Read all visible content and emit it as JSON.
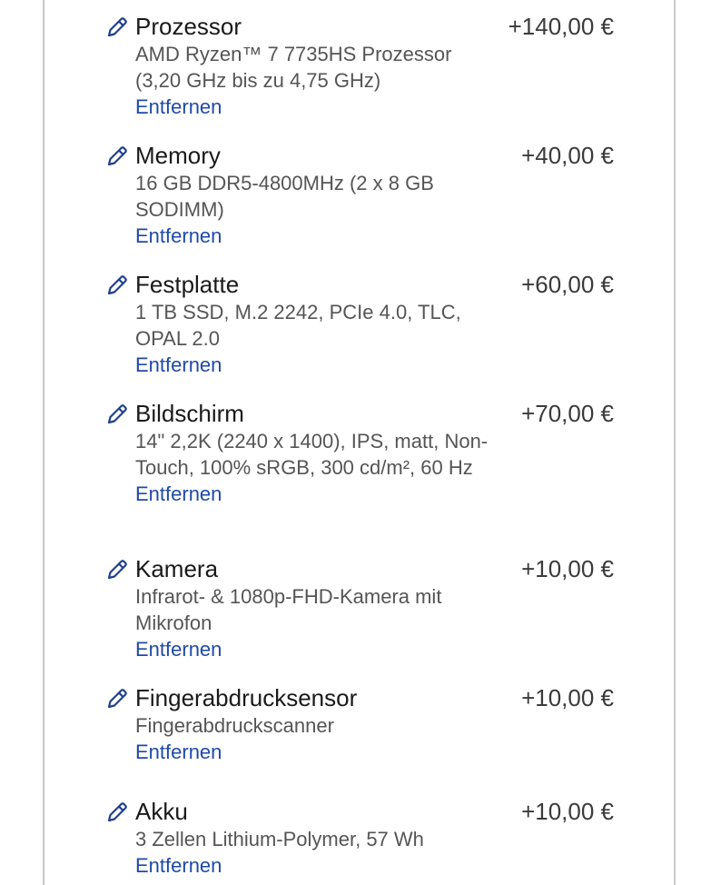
{
  "colors": {
    "title": "#1a1a1a",
    "price": "#3a3a3a",
    "description": "#555555",
    "link": "#1f4aa8",
    "icon": "#1f3f8f",
    "border": "#c9c9c9"
  },
  "items": [
    {
      "title": "Prozessor",
      "price": "+140,00 €",
      "description": "AMD Ryzen™ 7 7735HS Prozessor (3,20 GHz bis zu 4,75 GHz)",
      "remove_label": "Entfernen",
      "icon": "pencil-icon"
    },
    {
      "title": "Memory",
      "price": "+40,00 €",
      "description": "16 GB DDR5-4800MHz (2 x 8 GB SODIMM)",
      "remove_label": "Entfernen",
      "icon": "pencil-icon"
    },
    {
      "title": "Festplatte",
      "price": "+60,00 €",
      "description": "1 TB SSD, M.2 2242, PCIe 4.0, TLC, OPAL 2.0",
      "remove_label": "Entfernen",
      "icon": "pencil-icon"
    },
    {
      "title": "Bildschirm",
      "price": "+70,00 €",
      "description": "14\" 2,2K (2240 x 1400), IPS, matt, Non-Touch, 100% sRGB, 300 cd/m², 60 Hz",
      "remove_label": "Entfernen",
      "icon": "pencil-icon"
    },
    {
      "title": "Kamera",
      "price": "+10,00 €",
      "description": "Infrarot- & 1080p-FHD-Kamera mit Mikrofon",
      "remove_label": "Entfernen",
      "icon": "pencil-icon"
    },
    {
      "title": "Fingerabdrucksensor",
      "price": "+10,00 €",
      "description": "Fingerabdruckscanner",
      "remove_label": "Entfernen",
      "icon": "pencil-icon"
    },
    {
      "title": "Akku",
      "price": "+10,00 €",
      "description": "3 Zellen Lithium-Polymer, 57 Wh",
      "remove_label": "Entfernen",
      "icon": "pencil-icon"
    }
  ]
}
